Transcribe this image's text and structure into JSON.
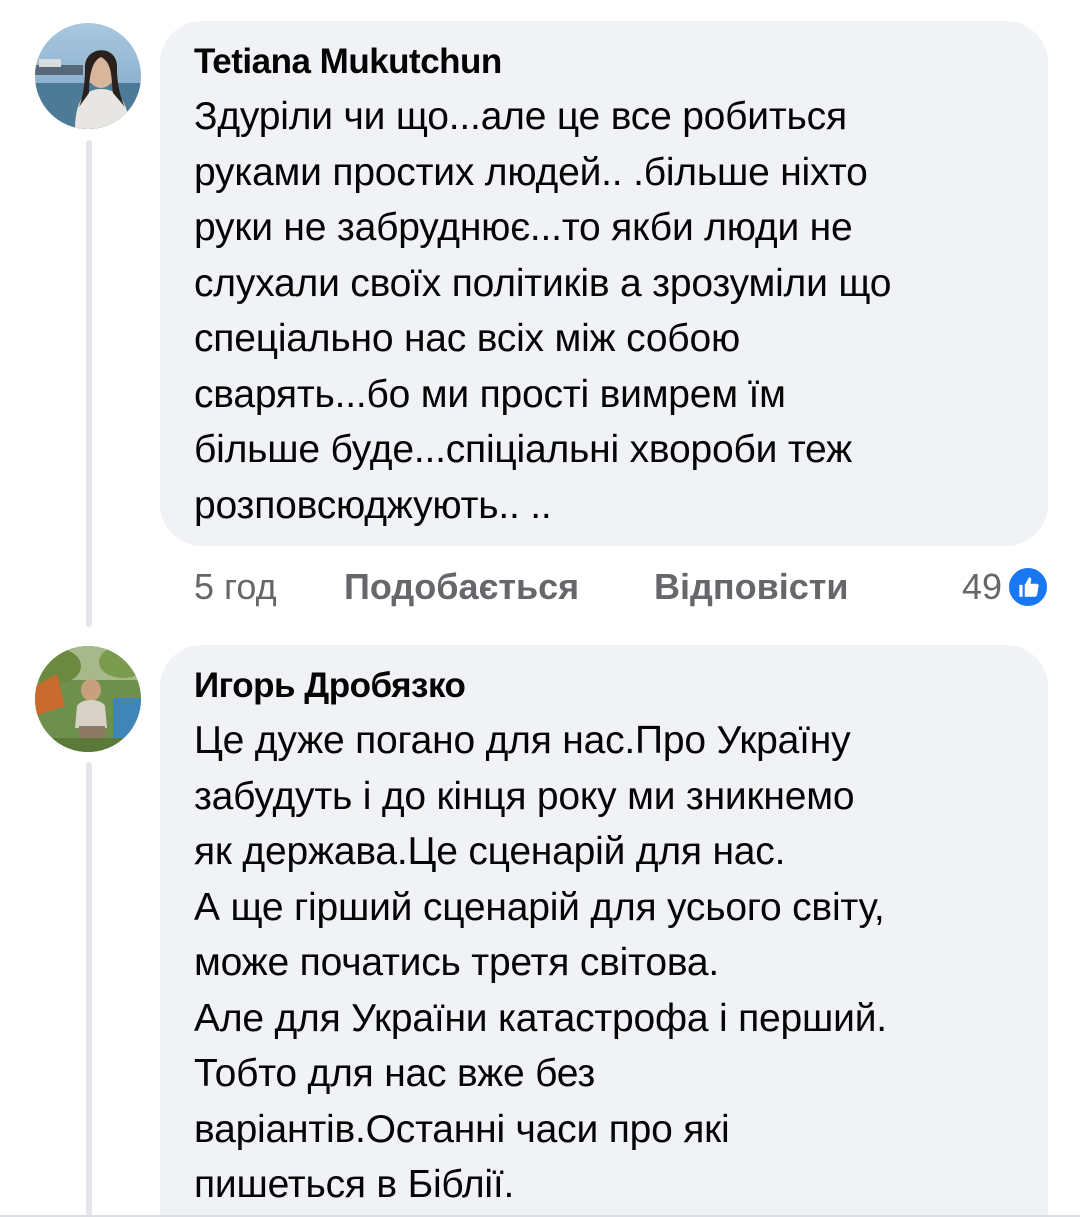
{
  "comments": [
    {
      "author": "Tetiana Mukutchun",
      "text": "Здуріли чи що...але це все робиться\nруками простих людей.. .більше ніхто\nруки не забруднює...то якби люди не\nслухали своїх політиків а зрозуміли що\nспеціально нас всіх між собою\nсварять...бо ми прості вимрем  їм\nбільше буде...спіціальні хвороби теж\nрозповсюджують.. ..",
      "time": "5 год",
      "like_label": "Подобається",
      "reply_label": "Відповісти",
      "reaction_count": "49",
      "reaction_icon": "like-thumb-icon"
    },
    {
      "author": "Игорь Дробязко",
      "text": "Це дуже погано для нас.Про Україну\nзабудуть і до кінця року ми зникнемо\nяк держава.Це сценарій для нас.\nА ще гірший сценарій для усього світу,\nможе початись третя світова.\nАле для України катастрофа і перший.\nТобто для нас вже без\nваріантів.Останні часи про які\nпишеться в Біблії."
    }
  ],
  "colors": {
    "bubble": "#f0f2f5",
    "meta_text": "#65676b",
    "like_blue": "#1877f2"
  }
}
